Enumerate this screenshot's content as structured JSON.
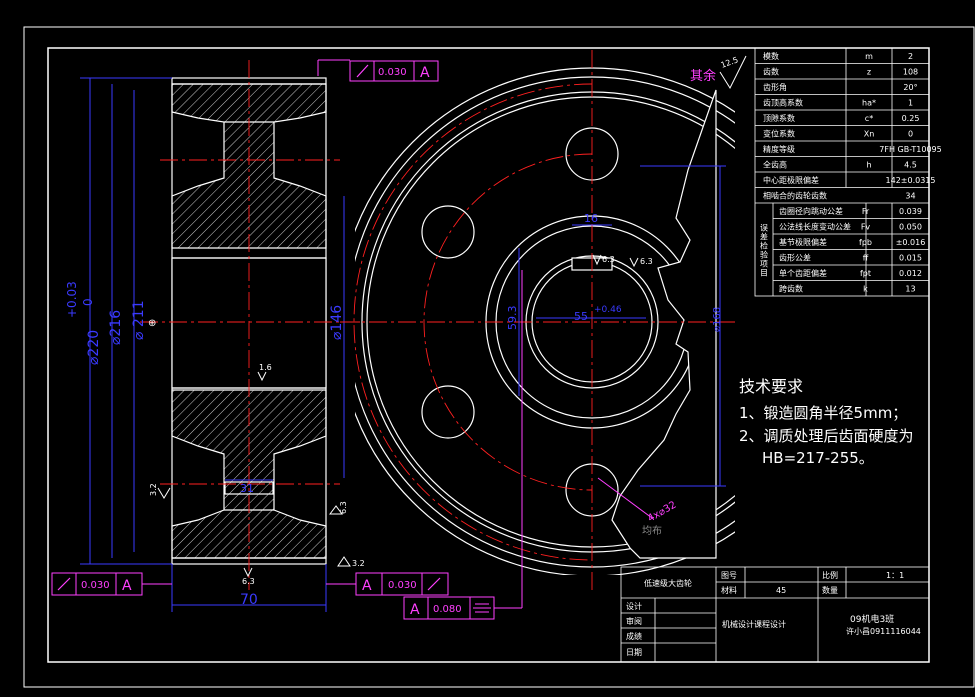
{
  "params_table": {
    "rows": [
      {
        "name": "模数",
        "symbol": "m",
        "value": "2"
      },
      {
        "name": "齿数",
        "symbol": "z",
        "value": "108"
      },
      {
        "name": "齿形角",
        "symbol": "",
        "value": "20°"
      },
      {
        "name": "齿顶高系数",
        "symbol": "ha*",
        "value": "1"
      },
      {
        "name": "顶隙系数",
        "symbol": "c*",
        "value": "0.25"
      },
      {
        "name": "变位系数",
        "symbol": "Xn",
        "value": "0"
      },
      {
        "name": "精度等级",
        "symbol": "",
        "value": "7FH GB-T10095"
      },
      {
        "name": "全齿高",
        "symbol": "h",
        "value": "4.5"
      },
      {
        "name": "中心距极限偏差",
        "symbol": "",
        "value": "142±0.0315"
      },
      {
        "name": "相啮合的齿轮齿数",
        "symbol": "",
        "value": "34"
      }
    ],
    "group_label": "误差检验项目",
    "group_rows": [
      {
        "name": "齿圈径向跳动公差",
        "symbol": "Fr",
        "value": "0.039"
      },
      {
        "name": "公法线长度变动公差",
        "symbol": "Fv",
        "value": "0.050"
      },
      {
        "name": "基节极限偏差",
        "symbol": "fpb",
        "value": "±0.016"
      },
      {
        "name": "齿形公差",
        "symbol": "ff",
        "value": "0.015"
      },
      {
        "name": "单个齿距偏差",
        "symbol": "fpt",
        "value": "0.012"
      },
      {
        "name": "跨齿数",
        "symbol": "k",
        "value": "13"
      }
    ]
  },
  "roughness": {
    "other_label": "其余",
    "value": "12.5"
  },
  "tech_requirements": {
    "title": "技术要求",
    "items": [
      "1、锻造圆角半径5mm；",
      "2、调质处理后齿面硬度为",
      "HB=217-255。"
    ]
  },
  "title_block": {
    "part_name": "低速级大齿轮",
    "drawing_no_label": "图号",
    "scale_label": "比例",
    "scale_value": "1：1",
    "material_label": "材料",
    "material_value": "45",
    "quantity_label": "数量",
    "design_label": "设计",
    "review_label": "审阅",
    "grade_label": "成绩",
    "date_label": "日期",
    "course": "机械设计课程设计",
    "class": "09机电3班",
    "student": "许小昌0911116044"
  },
  "dimensions": {
    "tip_dia": "⌀220",
    "tip_tol_upper": "+0.03",
    "tip_tol_lower": "0",
    "ref_dia": "⌀216",
    "root_dia": "⌀ 211",
    "hub_dia": "⌀146",
    "face_width": "70",
    "hub_len": "31",
    "keyway_width": "16",
    "bore": "55",
    "bore_tol": "+0.46",
    "key_depth": "59.3",
    "bore_fit": "⌀102",
    "web_holes": "4x⌀32",
    "outer_dim": "⌀168",
    "web_label": "均布"
  },
  "tolerance_frames": {
    "top": {
      "value": "0.030",
      "datum": "A"
    },
    "bottom_left": {
      "value": "0.030",
      "datum": "A"
    },
    "bottom_mid": {
      "value": "0.030",
      "datum": "A"
    },
    "symmetry": {
      "value": "0.080",
      "datum": "A"
    }
  },
  "roughness_marks": [
    "3.2",
    "6.3",
    "6.3",
    "1.6",
    "3.2",
    "6.3",
    "6.3"
  ],
  "colors": {
    "bg": "#000000",
    "line": "#ffffff",
    "center": "#ff2020",
    "dim": "#3a3aff",
    "frame": "#ff40ff",
    "text_label": "#ffcc66"
  }
}
